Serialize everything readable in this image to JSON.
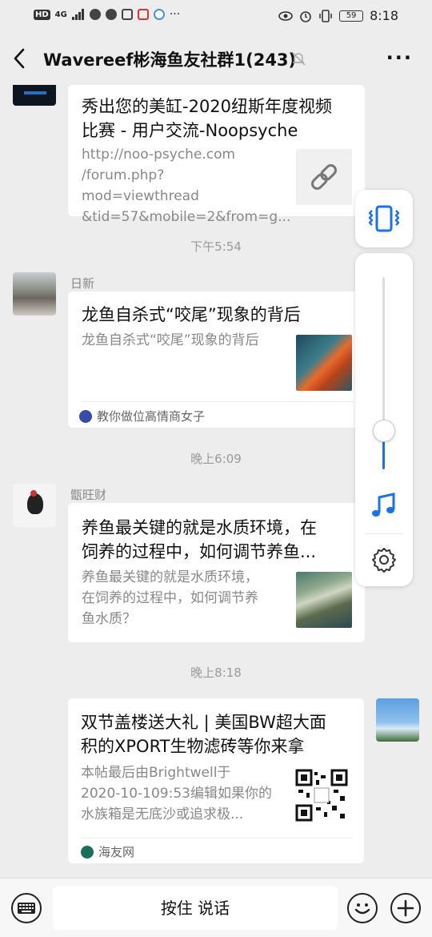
{
  "status_bar": {
    "network_badge": "HD",
    "signal": "4G",
    "battery": "59",
    "time": "8:18"
  },
  "header": {
    "back_icon": "chevron-left-icon",
    "title": "Wavereef彬海鱼友社群1(243)",
    "mute_icon": "bell-muted-icon",
    "more_label": "···"
  },
  "messages": [
    {
      "title": "秀出您的美缸-2020纽斯年度视频比赛 - 用户交流-Noopsyche",
      "title_line1": "秀出您的美缸-2020纽斯年度视频",
      "title_line2": "比赛 - 用户交流-Noopsyche",
      "desc_line1": "http://noo-psyche.com",
      "desc_line2": "/forum.php?mod=viewthread",
      "desc_line3": "&tid=57&mobile=2&from=g...",
      "thumb_icon": "link-icon"
    },
    {
      "time": "下午5:54",
      "sender": "日新",
      "title": "龙鱼自杀式“咬尾”现象的背后",
      "desc": "龙鱼自杀式“咬尾”现象的背后",
      "source": "教你做位高情商女子"
    },
    {
      "time": "晚上6:09",
      "sender": "甑旺财",
      "title_line1": "养鱼最关键的就是水质环境，在",
      "title_line2": "饲养的过程中，如何调节养鱼...",
      "desc_line1": "养鱼最关键的就是水质环境，",
      "desc_line2": "在饲养的过程中，如何调节养",
      "desc_line3": "鱼水质？"
    },
    {
      "time": "晚上8:18",
      "title_line1": "双节盖楼送大礼 | 美国BW超大面",
      "title_line2": "积的XPORT生物滤砖等你来拿",
      "desc_line1": "本帖最后由Brightwell于",
      "desc_line2": "2020-10-109:53编辑如果你的",
      "desc_line3": "水族箱是无底沙或追求极...",
      "source": "海友网"
    }
  ],
  "volume_panel": {
    "vibrate_icon": "vibrate-icon",
    "music_icon": "music-note-icon",
    "settings_icon": "gear-icon",
    "level": 0.2,
    "accent": "#1a73e8"
  },
  "bottom_bar": {
    "keyboard_icon": "keyboard-icon",
    "talk_label": "按住 说话",
    "emoji_icon": "smiley-icon",
    "plus_icon": "plus-icon"
  }
}
